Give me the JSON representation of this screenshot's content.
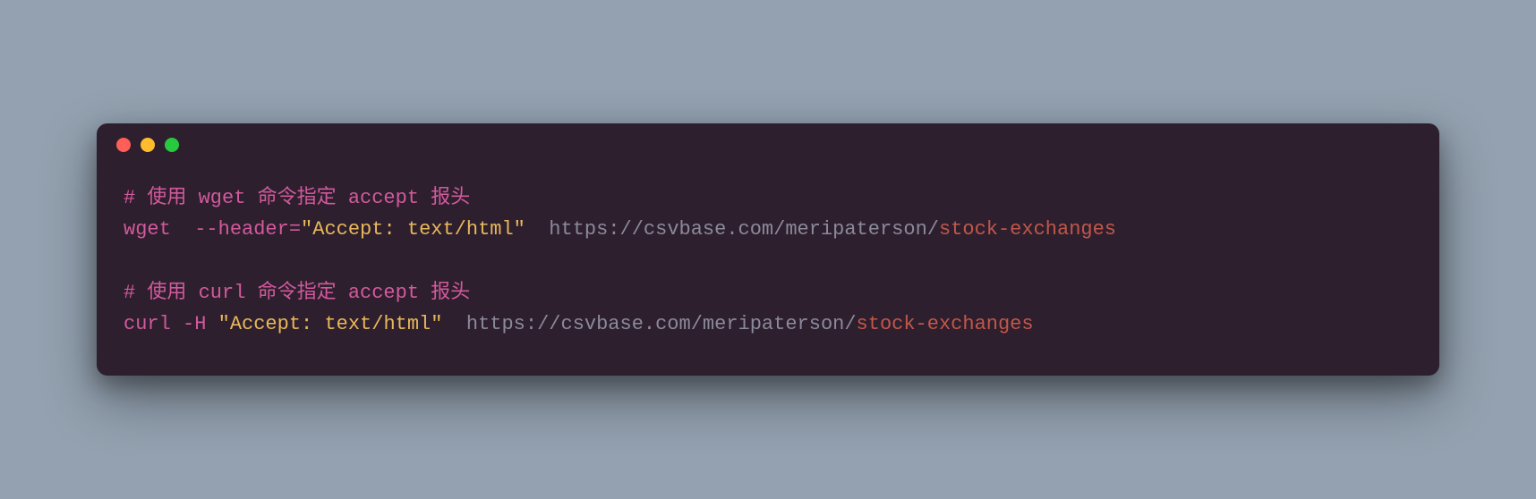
{
  "code": {
    "line1": {
      "comment": "# 使用 wget 命令指定 accept 报头"
    },
    "line2": {
      "cmd": "wget",
      "sp1": "  ",
      "flag": "--header=",
      "string": "\"Accept: text/html\"",
      "sp2": "  ",
      "urlbase": "https://csvbase.com/meripaterson/",
      "urlpath": "stock-exchanges"
    },
    "line4": {
      "comment": "# 使用 curl 命令指定 accept 报头"
    },
    "line5": {
      "cmd": "curl",
      "sp1": " ",
      "flag": "-H",
      "sp2": " ",
      "string": "\"Accept: text/html\"",
      "sp3": "  ",
      "urlbase": "https://csvbase.com/meripaterson/",
      "urlpath": "stock-exchanges"
    }
  }
}
